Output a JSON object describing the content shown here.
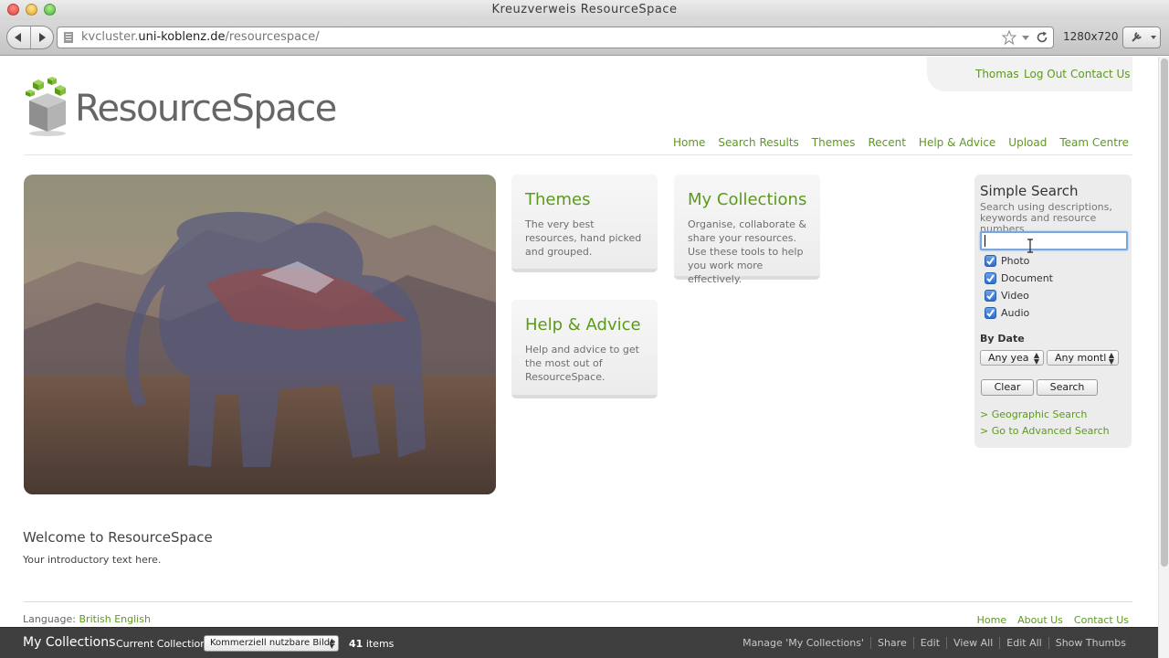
{
  "browser": {
    "window_title": "Kreuzverweis ResourceSpace",
    "url_prefix": "kvcluster.",
    "url_domain": "uni-koblenz.de",
    "url_path": "/resourcespace/",
    "resolution_label": "1280x720"
  },
  "logo": {
    "text": "ResourceSpace"
  },
  "user_links": {
    "username": "Thomas",
    "logout": "Log Out",
    "contact": "Contact Us"
  },
  "nav": [
    "Home",
    "Search Results",
    "Themes",
    "Recent",
    "Help & Advice",
    "Upload",
    "Team Centre"
  ],
  "tiles": {
    "themes": {
      "title": "Themes",
      "text": "The very best resources, hand picked and grouped."
    },
    "collections": {
      "title": "My Collections",
      "text": "Organise, collaborate & share your resources. Use these tools to help you work more effectively."
    },
    "help": {
      "title": "Help & Advice",
      "text": "Help and advice to get the most out of ResourceSpace."
    }
  },
  "search": {
    "title": "Simple Search",
    "description": "Search using descriptions, keywords and resource numbers",
    "input_value": "",
    "types": [
      {
        "label": "Photo",
        "checked": true
      },
      {
        "label": "Document",
        "checked": true
      },
      {
        "label": "Video",
        "checked": true
      },
      {
        "label": "Audio",
        "checked": true
      }
    ],
    "by_date_label": "By Date",
    "year_select": "Any yea",
    "month_select": "Any montl",
    "clear_label": "Clear",
    "search_label": "Search",
    "geo_link": "> Geographic Search",
    "advanced_link": "> Go to Advanced Search"
  },
  "welcome": {
    "title": "Welcome to ResourceSpace",
    "intro": "Your introductory text here."
  },
  "footer": {
    "language_label": "Language:",
    "language_value": "British English",
    "links": [
      "Home",
      "About Us",
      "Contact Us"
    ]
  },
  "collection_bar": {
    "title": "My Collections",
    "current_label": "Current Collection:",
    "current_value": "Kommerziell nutzbare Bilde",
    "count": "41",
    "count_suffix": "items",
    "actions": [
      "Manage 'My Collections'",
      "Share",
      "Edit",
      "View All",
      "Edit All",
      "Show Thumbs"
    ]
  },
  "colors": {
    "link_green": "#5c9a1c",
    "bar_dark": "#3f3f3f",
    "panel_grey": "#ececec"
  }
}
